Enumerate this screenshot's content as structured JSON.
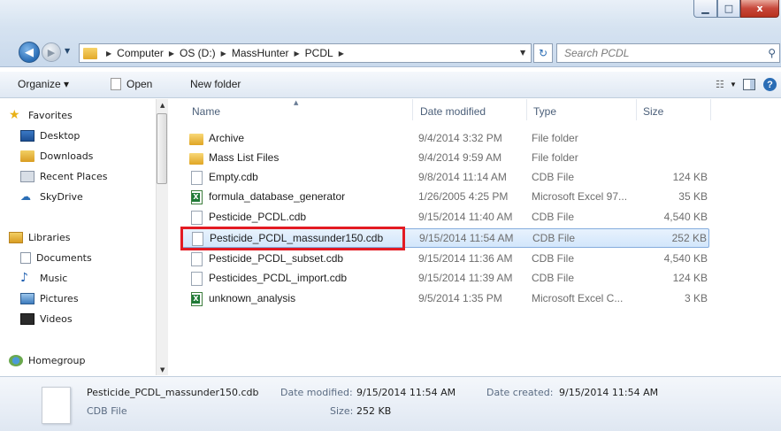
{
  "window": {
    "minimize_glyph": "▁",
    "maximize_glyph": "□",
    "close_glyph": "x"
  },
  "address": {
    "crumbs": [
      "Computer",
      "OS (D:)",
      "MassHunter",
      "PCDL"
    ],
    "search_placeholder": "Search PCDL"
  },
  "toolbar": {
    "organize": "Organize ▾",
    "open": "Open",
    "new_folder": "New folder"
  },
  "nav": {
    "favorites": "Favorites",
    "desktop": "Desktop",
    "downloads": "Downloads",
    "recent_places": "Recent Places",
    "skydrive": "SkyDrive",
    "libraries": "Libraries",
    "documents": "Documents",
    "music": "Music",
    "pictures": "Pictures",
    "videos": "Videos",
    "homegroup": "Homegroup"
  },
  "columns": {
    "name": "Name",
    "date": "Date modified",
    "type": "Type",
    "size": "Size"
  },
  "files": [
    {
      "name": "Archive",
      "date": "9/4/2014 3:32 PM",
      "type": "File folder",
      "size": "",
      "icon": "folder-icon"
    },
    {
      "name": "Mass List Files",
      "date": "9/4/2014 9:59 AM",
      "type": "File folder",
      "size": "",
      "icon": "folder-icon"
    },
    {
      "name": "Empty.cdb",
      "date": "9/8/2014 11:14 AM",
      "type": "CDB File",
      "size": "124 KB",
      "icon": "file-icon"
    },
    {
      "name": "formula_database_generator",
      "date": "1/26/2005 4:25 PM",
      "type": "Microsoft Excel 97...",
      "size": "35 KB",
      "icon": "excel-icon"
    },
    {
      "name": "Pesticide_PCDL.cdb",
      "date": "9/15/2014 11:40 AM",
      "type": "CDB File",
      "size": "4,540 KB",
      "icon": "file-icon"
    },
    {
      "name": "Pesticide_PCDL_massunder150.cdb",
      "date": "9/15/2014 11:54 AM",
      "type": "CDB File",
      "size": "252 KB",
      "icon": "file-icon"
    },
    {
      "name": "Pesticide_PCDL_subset.cdb",
      "date": "9/15/2014 11:36 AM",
      "type": "CDB File",
      "size": "4,540 KB",
      "icon": "file-icon"
    },
    {
      "name": "Pesticides_PCDL_import.cdb",
      "date": "9/15/2014 11:39 AM",
      "type": "CDB File",
      "size": "124 KB",
      "icon": "file-icon"
    },
    {
      "name": "unknown_analysis",
      "date": "9/5/2014 1:35 PM",
      "type": "Microsoft Excel C...",
      "size": "3 KB",
      "icon": "excel-icon"
    }
  ],
  "details": {
    "filename": "Pesticide_PCDL_massunder150.cdb",
    "filetype": "CDB File",
    "date_modified_label": "Date modified:",
    "date_modified": "9/15/2014 11:54 AM",
    "size_label": "Size:",
    "size": "252 KB",
    "date_created_label": "Date created:",
    "date_created": "9/15/2014 11:54 AM"
  },
  "colors": {
    "selection_border": "#84acdd",
    "highlight_box": "#e31b23",
    "accent": "#2a6db5"
  }
}
